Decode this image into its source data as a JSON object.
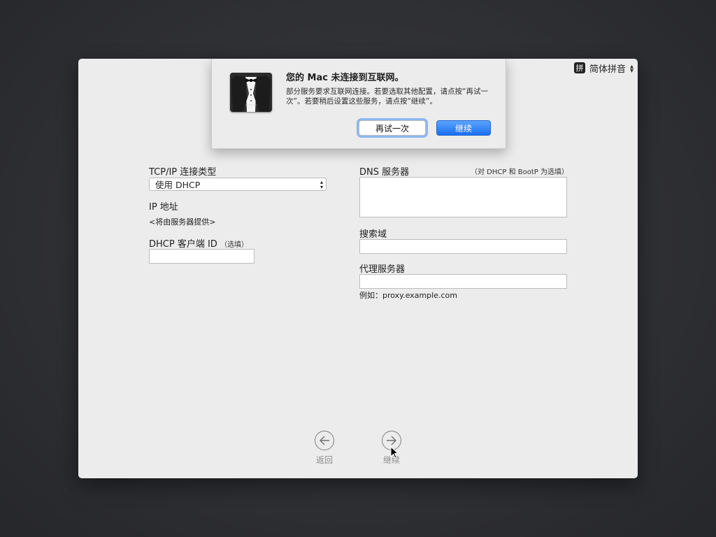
{
  "input_method": {
    "badge": "拼",
    "name": "简体拼音"
  },
  "alert": {
    "title": "您的 Mac 未连接到互联网。",
    "message": "部分服务要求互联网连接。若要选取其他配置，请点按“再试一次”。若要稍后设置这些服务，请点按“继续”。",
    "retry_label": "再试一次",
    "continue_label": "继续"
  },
  "form": {
    "tcpip_label": "TCP/IP 连接类型",
    "tcpip_value": "使用 DHCP",
    "ip_label": "IP 地址",
    "ip_value": "<将由服务器提供>",
    "dhcp_id_label": "DHCP 客户端 ID",
    "dhcp_id_hint": "（选填）",
    "dhcp_id_value": "",
    "dns_label": "DNS 服务器",
    "dns_hint": "（对 DHCP 和 BootP 为选填）",
    "dns_value": "",
    "search_label": "搜索域",
    "search_value": "",
    "proxy_label": "代理服务器",
    "proxy_value": "",
    "proxy_example": "例如：proxy.example.com"
  },
  "nav": {
    "back_label": "返回",
    "continue_label": "继续"
  },
  "colors": {
    "accent": "#1a6ff0",
    "focus_ring": "#8db7f0",
    "window_bg": "#ececec"
  }
}
